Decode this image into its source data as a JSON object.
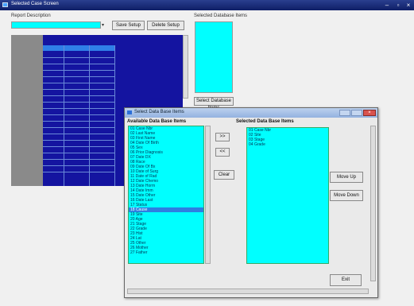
{
  "window": {
    "title": "Selected Case Screen"
  },
  "report_description": {
    "label": "Report Description",
    "value": ""
  },
  "buttons": {
    "save_setup": "Save Setup",
    "delete_setup": "Delete Setup"
  },
  "selected_db_items": {
    "label": "Selected Database Items",
    "button": "Select Database Items"
  },
  "dialog": {
    "title": "Select Data Base Items",
    "available_label": "Available Data Base Items",
    "selected_label": "Selected Data Base Items",
    "available_items": [
      "01 Case Nbr",
      "02 Last Name",
      "03 First Name",
      "04 Date Of Birth",
      "05 Sex",
      "06 Prior Diagnosis",
      "07 Date DX",
      "08 Race",
      "09 Date Of Bx",
      "10 Date of Surg",
      "11 Date of Rad",
      "12 Date Chemo",
      "13 Date Horm",
      "14 Date Imm",
      "15 Date Other",
      "16 Date Last",
      "17 Status",
      "18 Cause",
      "19 Site",
      "20 Age",
      "21 Stage",
      "22 Grade",
      "23 Hist",
      "24 Lat",
      "25 Other",
      "26 Mother",
      "27 Father"
    ],
    "available_selected_index": 17,
    "selected_items": [
      "01 Case Nbr",
      "02 Site",
      "03 Stage",
      "04 Grade"
    ],
    "add_button": ">>",
    "remove_button": "<<",
    "clear_button": "Clear",
    "move_up": "Move Up",
    "move_down": "Move Down",
    "exit": "Exit"
  }
}
